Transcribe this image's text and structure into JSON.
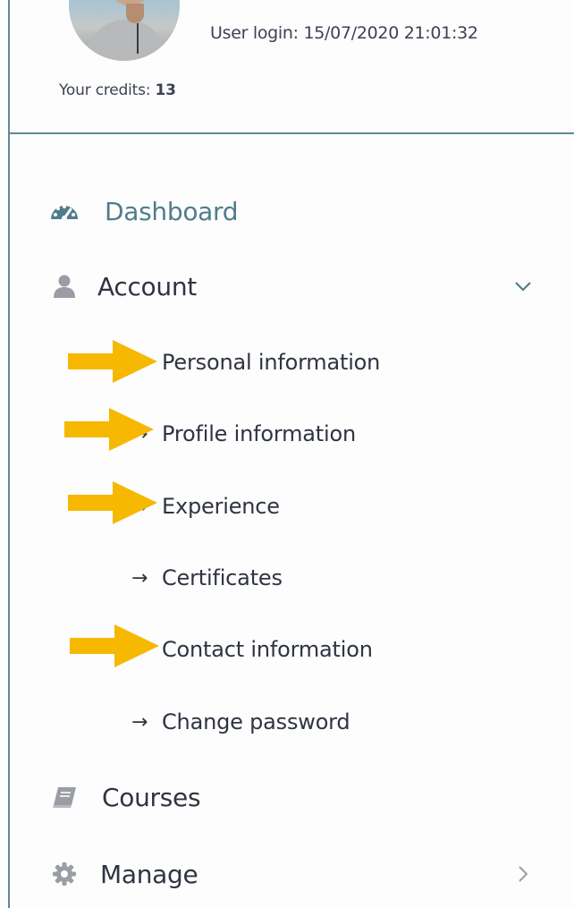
{
  "profile": {
    "login_label": "User login: 15/07/2020 21:01:32",
    "credits_label": "Your credits: ",
    "credits_value": "13"
  },
  "nav": {
    "dashboard": {
      "label": "Dashboard",
      "icon": "dashboard-gauge-icon",
      "active": true
    },
    "account": {
      "label": "Account",
      "icon": "user-icon",
      "expanded": true,
      "sub_items": [
        {
          "label": "Personal information",
          "arrow": "→",
          "highlighted": true
        },
        {
          "label": "Profile information",
          "arrow": "→",
          "highlighted": true
        },
        {
          "label": "Experience",
          "arrow": "→",
          "highlighted": true
        },
        {
          "label": "Certificates",
          "arrow": "→",
          "highlighted": false
        },
        {
          "label": "Contact information",
          "arrow": "→",
          "highlighted": true
        },
        {
          "label": "Change password",
          "arrow": "→",
          "highlighted": false
        }
      ]
    },
    "courses": {
      "label": "Courses",
      "icon": "book-icon"
    },
    "manage": {
      "label": "Manage",
      "icon": "gear-icon"
    }
  },
  "colors": {
    "accent": "#4f7d8c",
    "rule": "#5e8a96",
    "text": "#2f3442",
    "annotation_arrow": "#f6b800",
    "icon_gray": "#9a9ea4"
  }
}
